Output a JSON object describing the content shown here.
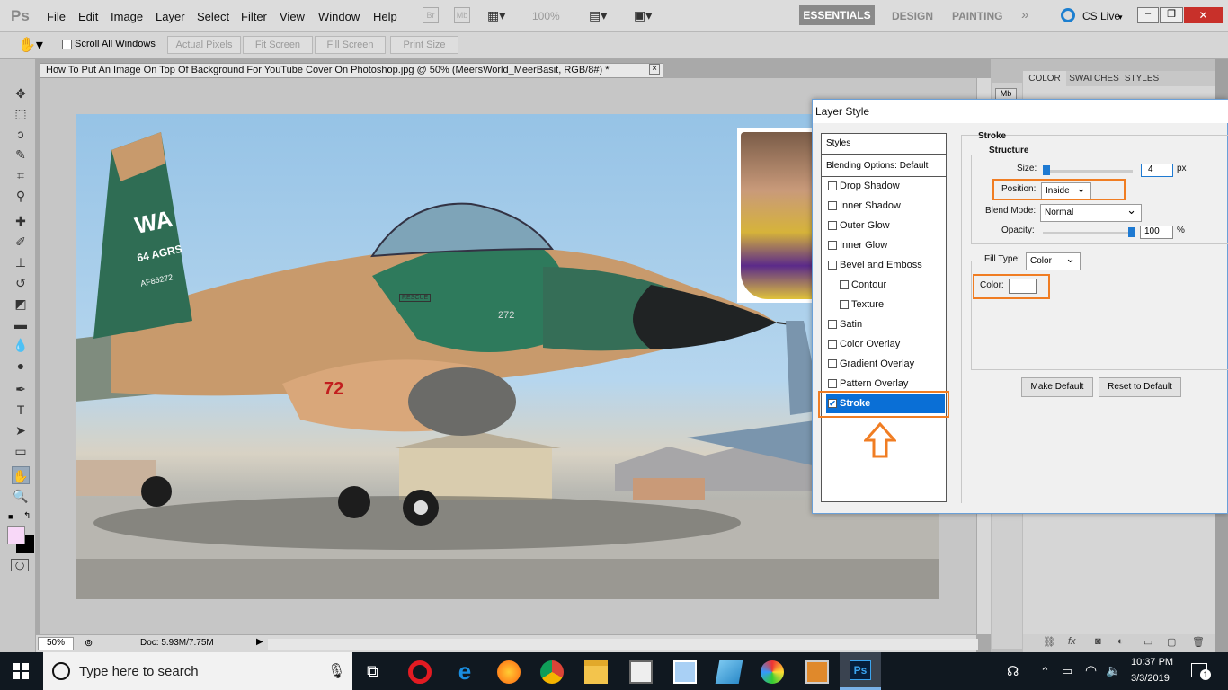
{
  "app": {
    "logo": "Ps"
  },
  "menu": [
    "File",
    "Edit",
    "Image",
    "Layer",
    "Select",
    "Filter",
    "View",
    "Window",
    "Help"
  ],
  "menubar": {
    "zoom": "100%",
    "workspaces": [
      "ESSENTIALS",
      "DESIGN",
      "PAINTING"
    ],
    "more": "»",
    "cslive": "CS Live"
  },
  "options": {
    "scroll_all": "Scroll All Windows",
    "buttons": [
      "Actual Pixels",
      "Fit Screen",
      "Fill Screen",
      "Print Size"
    ]
  },
  "document": {
    "tab_title": "How To Put An Image On Top Of Background For YouTube Cover On Photoshop.jpg @ 50% (MeersWorld_MeerBasit, RGB/8#) *",
    "close": "×"
  },
  "status": {
    "zoom": "50%",
    "doc_info": "Doc: 5.93M/7.75M"
  },
  "panel": {
    "tabs": [
      "COLOR",
      "SWATCHES",
      "STYLES"
    ]
  },
  "dialog": {
    "title": "Layer Style",
    "list_header": "Styles",
    "blending": "Blending Options: Default",
    "items": [
      {
        "label": "Drop Shadow",
        "checked": false,
        "indent": false
      },
      {
        "label": "Inner Shadow",
        "checked": false,
        "indent": false
      },
      {
        "label": "Outer Glow",
        "checked": false,
        "indent": false
      },
      {
        "label": "Inner Glow",
        "checked": false,
        "indent": false
      },
      {
        "label": "Bevel and Emboss",
        "checked": false,
        "indent": false
      },
      {
        "label": "Contour",
        "checked": false,
        "indent": true
      },
      {
        "label": "Texture",
        "checked": false,
        "indent": true
      },
      {
        "label": "Satin",
        "checked": false,
        "indent": false
      },
      {
        "label": "Color Overlay",
        "checked": false,
        "indent": false
      },
      {
        "label": "Gradient Overlay",
        "checked": false,
        "indent": false
      },
      {
        "label": "Pattern Overlay",
        "checked": false,
        "indent": false
      },
      {
        "label": "Stroke",
        "checked": true,
        "indent": false
      }
    ],
    "stroke": {
      "heading": "Stroke",
      "structure": "Structure",
      "size_label": "Size:",
      "size_value": "4",
      "size_unit": "px",
      "position_label": "Position:",
      "position_value": "Inside",
      "blend_label": "Blend Mode:",
      "blend_value": "Normal",
      "opacity_label": "Opacity:",
      "opacity_value": "100",
      "opacity_unit": "%",
      "filltype_label": "Fill Type:",
      "filltype_value": "Color",
      "color_label": "Color:",
      "color_value": "#ffffff"
    },
    "make_default": "Make Default",
    "reset_default": "Reset to Default"
  },
  "photo_text": {
    "tail": "WA",
    "tail2": "64 AGRS",
    "tail3": "AF86272",
    "nose_num": "272",
    "intake": "72",
    "rescue": "RESCUE"
  },
  "taskbar": {
    "search_placeholder": "Type here to search",
    "time": "10:37 PM",
    "date": "3/3/2019",
    "notifications": "1"
  },
  "colors": {
    "accent": "#0078d7",
    "highlight": "#f07d23",
    "selected": "#0a6fd6",
    "foreground_swatch": "#f8d8f8"
  }
}
